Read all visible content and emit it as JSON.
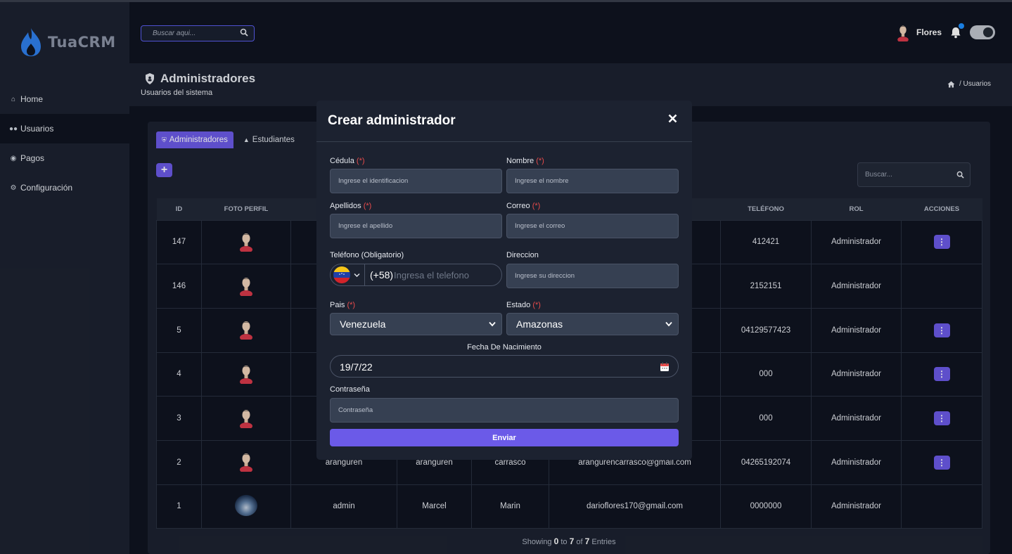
{
  "app": {
    "brand": "TuaCRM"
  },
  "search_top": {
    "placeholder": "Buscar aqui..."
  },
  "user": {
    "name": "Flores"
  },
  "sidebar": {
    "items": [
      {
        "label": "Home",
        "icon": "home-icon"
      },
      {
        "label": "Usuarios",
        "icon": "users-icon",
        "active": true
      },
      {
        "label": "Pagos",
        "icon": "payments-icon"
      },
      {
        "label": "Configuración",
        "icon": "cogs-icon"
      }
    ]
  },
  "page": {
    "title": "Administradores",
    "subtitle": "Usuarios del sistema",
    "breadcrumb": "/ Usuarios"
  },
  "tabs": [
    {
      "label": "Administradores",
      "active": true
    },
    {
      "label": "Estudiantes"
    }
  ],
  "card_search": {
    "placeholder": "Buscar..."
  },
  "table": {
    "headers": [
      "ID",
      "FOTO PERFIL",
      "",
      "",
      "",
      "",
      "TELÉFONO",
      "ROL",
      "ACCIONES"
    ],
    "rows": [
      {
        "id": "147",
        "c3": "",
        "c4": "",
        "c5": "",
        "email": "",
        "phone": "412421",
        "role": "Administrador",
        "action": true,
        "photo": false
      },
      {
        "id": "146",
        "c3": "",
        "c4": "",
        "c5": "",
        "email": "",
        "phone": "2152151",
        "role": "Administrador",
        "action": false,
        "photo": false
      },
      {
        "id": "5",
        "c3": "",
        "c4": "",
        "c5": "",
        "email": "",
        "phone": "04129577423",
        "role": "Administrador",
        "action": true,
        "photo": false
      },
      {
        "id": "4",
        "c3": "",
        "c4": "",
        "c5": "",
        "email": "",
        "phone": "000",
        "role": "Administrador",
        "action": true,
        "photo": false
      },
      {
        "id": "3",
        "c3": "",
        "c4": "",
        "c5": "",
        "email": "",
        "phone": "000",
        "role": "Administrador",
        "action": true,
        "photo": false
      },
      {
        "id": "2",
        "c3": "aranguren",
        "c4": "aranguren",
        "c5": "carrasco",
        "email": "arangurencarrasco@gmail.com",
        "phone": "04265192074",
        "role": "Administrador",
        "action": true,
        "photo": false
      },
      {
        "id": "1",
        "c3": "admin",
        "c4": "Marcel",
        "c5": "Marin",
        "email": "darioflores170@gmail.com",
        "phone": "0000000",
        "role": "Administrador",
        "action": false,
        "photo": true
      }
    ]
  },
  "footer": {
    "showing": "Showing",
    "from": "0",
    "to_label": "to",
    "to": "7",
    "of_label": "of",
    "total": "7",
    "entries": "Entries"
  },
  "modal": {
    "title": "Crear administrador",
    "cedula_label": "Cédula",
    "cedula_placeholder": "Ingrese el identificacion",
    "nombre_label": "Nombre",
    "nombre_placeholder": "Ingrese el nombre",
    "apellidos_label": "Apellidos",
    "apellidos_placeholder": "Ingrese el apellido",
    "correo_label": "Correo",
    "correo_placeholder": "Ingrese el correo",
    "telefono_label": "Teléfono (Obligatorio)",
    "phone_code": "(+58)",
    "phone_placeholder": "Ingresa el telefono",
    "direccion_label": "Direccion",
    "direccion_placeholder": "Ingrese su direccion",
    "pais_label": "Pais",
    "pais_value": "Venezuela",
    "estado_label": "Estado",
    "estado_value": "Amazonas",
    "fecha_label": "Fecha De Nacimiento",
    "fecha_value": "19/7/22",
    "contrasena_label": "Contraseña",
    "contrasena_placeholder": "Contraseña",
    "required_mark": "(*)",
    "submit": "Enviar"
  },
  "colors": {
    "accent": "#6b5ae8",
    "sidebar": "#1c2230",
    "background": "#0f1420",
    "required": "#e84b4b"
  }
}
